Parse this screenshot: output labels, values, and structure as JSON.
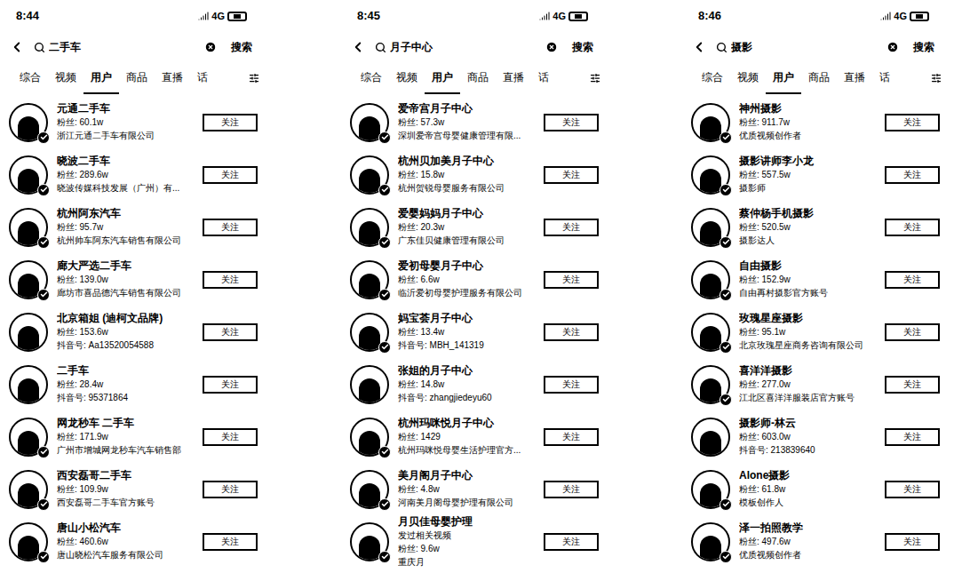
{
  "panels": [
    {
      "time": "8:44",
      "network": "4G",
      "query": "二手车",
      "search_button": "搜索",
      "tabs": [
        {
          "label": "综合",
          "selected": false
        },
        {
          "label": "视频",
          "selected": false
        },
        {
          "label": "用户",
          "selected": true
        },
        {
          "label": "商品",
          "selected": false
        },
        {
          "label": "直播",
          "selected": false
        },
        {
          "label": "话",
          "selected": false
        }
      ],
      "users": [
        {
          "name": "元通二手车",
          "fans": "60.1w",
          "note": "",
          "subtitle": "浙江元通二手车有限公司",
          "verified": true
        },
        {
          "name": "晓波二手车",
          "fans": "289.6w",
          "note": "",
          "subtitle": "晓波传媒科技发展（广州）有...",
          "verified": true
        },
        {
          "name": "杭州阿东汽车",
          "fans": "95.7w",
          "note": "",
          "subtitle": "杭州帅车阿东汽车销售有限公司",
          "verified": true
        },
        {
          "name": "廊大严选二手车",
          "fans": "139.0w",
          "note": "",
          "subtitle": "廊坊市喜品德汽车销售有限公司",
          "verified": true
        },
        {
          "name": "北京箱姐 (迪柯文品牌)",
          "fans": "153.6w",
          "note": "",
          "subtitle": "抖音号: Aa13520054588",
          "verified": false
        },
        {
          "name": "二手车",
          "fans": "28.4w",
          "note": "",
          "subtitle": "抖音号: 95371864",
          "verified": false
        },
        {
          "name": "网龙秒车 二手车",
          "fans": "171.9w",
          "note": "",
          "subtitle": "广州市增城网龙秒车汽车销售部",
          "verified": true
        },
        {
          "name": "西安磊哥二手车",
          "fans": "109.9w",
          "note": "",
          "subtitle": "西安磊哥二手车官方账号",
          "verified": true
        },
        {
          "name": "唐山小松汽车",
          "fans": "460.6w",
          "note": "",
          "subtitle": "唐山晓松汽车服务有限公司",
          "verified": true
        }
      ]
    },
    {
      "time": "8:45",
      "network": "4G",
      "query": "月子中心",
      "search_button": "搜索",
      "tabs": [
        {
          "label": "综合",
          "selected": false
        },
        {
          "label": "视频",
          "selected": false
        },
        {
          "label": "用户",
          "selected": true
        },
        {
          "label": "商品",
          "selected": false
        },
        {
          "label": "直播",
          "selected": false
        },
        {
          "label": "话",
          "selected": false
        }
      ],
      "users": [
        {
          "name": "爱帝宫月子中心",
          "fans": "57.3w",
          "note": "",
          "subtitle": "深圳爱帝宫母婴健康管理有限...",
          "verified": true
        },
        {
          "name": "杭州贝加美月子中心",
          "fans": "15.8w",
          "note": "",
          "subtitle": "杭州贺锐母婴服务有限公司",
          "verified": true
        },
        {
          "name": "爱婴妈妈月子中心",
          "fans": "20.3w",
          "note": "",
          "subtitle": "广东佳贝健康管理有限公司",
          "verified": true
        },
        {
          "name": "爱初母婴月子中心",
          "fans": "6.6w",
          "note": "",
          "subtitle": "临沂爱初母婴护理服务有限公司",
          "verified": true
        },
        {
          "name": "妈宝荟月子中心",
          "fans": "13.4w",
          "note": "",
          "subtitle": "抖音号: MBH_141319",
          "verified": true
        },
        {
          "name": "张姐的月子中心",
          "fans": "14.8w",
          "note": "",
          "subtitle": "抖音号: zhangjiedeyu60",
          "verified": false
        },
        {
          "name": "杭州玛咪悦月子中心",
          "fans": "1429",
          "note": "",
          "subtitle": "杭州玛咪悦母婴生活护理官方...",
          "verified": true
        },
        {
          "name": "美月阁月子中心",
          "fans": "4.8w",
          "note": "",
          "subtitle": "河南美月阁母婴护理有限公司",
          "verified": true
        },
        {
          "name": "月贝佳母婴护理",
          "fans": "9.6w",
          "note": "发过相关视频",
          "subtitle": "重庆月",
          "verified": true
        }
      ]
    },
    {
      "time": "8:46",
      "network": "4G",
      "query": "摄影",
      "search_button": "搜索",
      "tabs": [
        {
          "label": "综合",
          "selected": false
        },
        {
          "label": "视频",
          "selected": false
        },
        {
          "label": "用户",
          "selected": true
        },
        {
          "label": "商品",
          "selected": false
        },
        {
          "label": "直播",
          "selected": false
        },
        {
          "label": "话",
          "selected": false
        }
      ],
      "users": [
        {
          "name": "神州摄影",
          "fans": "911.7w",
          "note": "",
          "subtitle": "优质视频创作者",
          "verified": true
        },
        {
          "name": "摄影讲师李小龙",
          "fans": "557.5w",
          "note": "",
          "subtitle": "摄影师",
          "verified": true
        },
        {
          "name": "蔡仲杨手机摄影",
          "fans": "520.5w",
          "note": "",
          "subtitle": "摄影达人",
          "verified": true
        },
        {
          "name": "自由摄影",
          "fans": "152.9w",
          "note": "",
          "subtitle": "自由再村摄影官方账号",
          "verified": true
        },
        {
          "name": "玫瑰星座摄影",
          "fans": "95.1w",
          "note": "",
          "subtitle": "北京玫瑰星座商务咨询有限公司",
          "verified": true
        },
        {
          "name": "喜洋洋摄影",
          "fans": "277.0w",
          "note": "",
          "subtitle": "江北区喜洋洋服装店官方账号",
          "verified": true
        },
        {
          "name": "摄影师-林云",
          "fans": "603.0w",
          "note": "",
          "subtitle": "抖音号: 213839640",
          "verified": false
        },
        {
          "name": "Alone摄影",
          "fans": "61.8w",
          "note": "",
          "subtitle": "模板创作人",
          "verified": true
        },
        {
          "name": "泽一拍照教学",
          "fans": "497.6w",
          "note": "",
          "subtitle": "优质视频创作者",
          "verified": true
        }
      ]
    }
  ],
  "fans_label": "粉丝:",
  "follow_label": "关注"
}
